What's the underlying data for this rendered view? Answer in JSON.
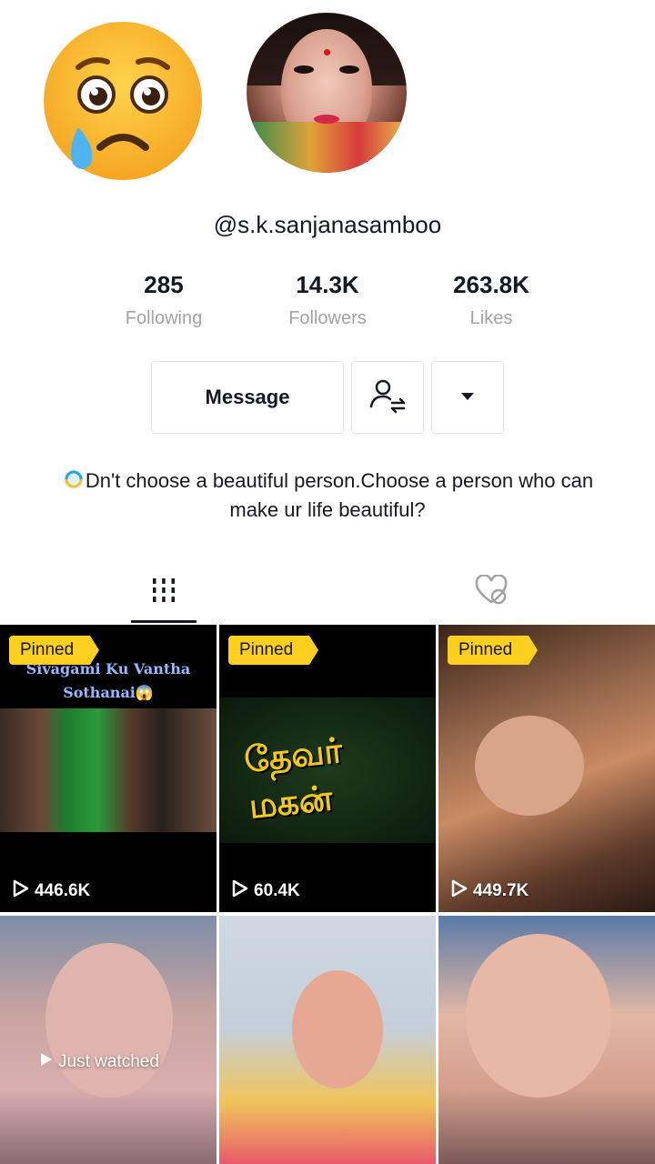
{
  "profile": {
    "username": "@s.k.sanjanasamboo",
    "bio": "Dn't choose a beautiful person.Choose a person who can make ur life beautiful?",
    "bio_icon": "loading-swirl-emoji"
  },
  "stats": {
    "following": {
      "value": "285",
      "label": "Following"
    },
    "followers": {
      "value": "14.3K",
      "label": "Followers"
    },
    "likes": {
      "value": "263.8K",
      "label": "Likes"
    }
  },
  "actions": {
    "message_label": "Message",
    "friends_icon": "user-swap-icon",
    "more_icon": "caret-down-icon"
  },
  "tabs": [
    {
      "name": "videos",
      "icon": "grid-icon",
      "active": true
    },
    {
      "name": "liked",
      "icon": "heart-hidden-icon",
      "active": false
    }
  ],
  "videos": [
    {
      "pinned_label": "Pinned",
      "views": "446.6K",
      "caption": [
        "Sivagami Ku Vantha",
        "Sothanai😱"
      ]
    },
    {
      "pinned_label": "Pinned",
      "views": "60.4K",
      "title_text": "தேவர் மகன்"
    },
    {
      "pinned_label": "Pinned",
      "views": "449.7K"
    },
    {
      "overlay": "Just watched"
    },
    {},
    {}
  ],
  "colors": {
    "pinned_badge": "#fdd01f",
    "text_primary": "#161823",
    "text_secondary": "#a1a2a7",
    "border": "#e3e3e4"
  },
  "sticker": "crying-face-emoji"
}
